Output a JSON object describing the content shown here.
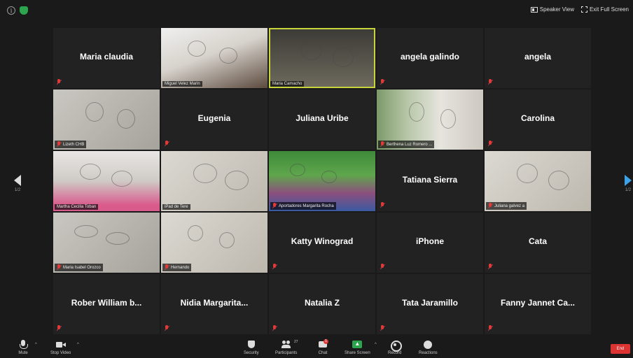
{
  "topbar": {
    "speaker_view": "Speaker View",
    "exit_fullscreen": "Exit Full Screen"
  },
  "grid": {
    "page_left": "1/2",
    "page_right": "1/2",
    "tiles": [
      {
        "name": "Maria claudia",
        "label": "",
        "video": false,
        "muted": true
      },
      {
        "name": "",
        "label": "Miguel Velez Marin",
        "video": true,
        "muted": false
      },
      {
        "name": "",
        "label": "Maria Camacho",
        "video": true,
        "muted": false,
        "active": true
      },
      {
        "name": "angela galindo",
        "label": "",
        "video": false,
        "muted": true
      },
      {
        "name": "angela",
        "label": "",
        "video": false,
        "muted": true
      },
      {
        "name": "",
        "label": "Lizeth CHB",
        "video": true,
        "muted": true
      },
      {
        "name": "Eugenia",
        "label": "",
        "video": false,
        "muted": true
      },
      {
        "name": "Juliana Uribe",
        "label": "",
        "video": false,
        "muted": false
      },
      {
        "name": "",
        "label": "Berthena Luz Romero ...",
        "video": true,
        "muted": true
      },
      {
        "name": "Carolina",
        "label": "",
        "video": false,
        "muted": true
      },
      {
        "name": "",
        "label": "Martha Cecilia Toban",
        "video": true,
        "muted": false
      },
      {
        "name": "",
        "label": "iPad de Tere",
        "video": true,
        "muted": false
      },
      {
        "name": "",
        "label": "Aportadores Margarita Rocha",
        "video": true,
        "muted": true
      },
      {
        "name": "Tatiana Sierra",
        "label": "",
        "video": false,
        "muted": true
      },
      {
        "name": "",
        "label": "Juliana galvez a",
        "video": true,
        "muted": true
      },
      {
        "name": "",
        "label": "Maria Isabel Orozco",
        "video": true,
        "muted": true
      },
      {
        "name": "",
        "label": "Hernando",
        "video": true,
        "muted": true
      },
      {
        "name": "Katty Winograd",
        "label": "",
        "video": false,
        "muted": true
      },
      {
        "name": "iPhone",
        "label": "",
        "video": false,
        "muted": true
      },
      {
        "name": "Cata",
        "label": "",
        "video": false,
        "muted": true
      },
      {
        "name": "Rober William b...",
        "label": "",
        "video": false,
        "muted": true
      },
      {
        "name": "Nidia Margarita...",
        "label": "",
        "video": false,
        "muted": true
      },
      {
        "name": "Natalia Z",
        "label": "",
        "video": false,
        "muted": true
      },
      {
        "name": "Tata Jaramillo",
        "label": "",
        "video": false,
        "muted": true
      },
      {
        "name": "Fanny Jannet Ca...",
        "label": "",
        "video": false,
        "muted": true
      }
    ]
  },
  "toolbar": {
    "mute": "Mute",
    "stop_video": "Stop Video",
    "security": "Security",
    "participants": "Participants",
    "participants_count": "27",
    "chat": "Chat",
    "chat_badge": "1",
    "share_screen": "Share Screen",
    "record": "Record",
    "reactions": "Reactions",
    "end": "End"
  }
}
